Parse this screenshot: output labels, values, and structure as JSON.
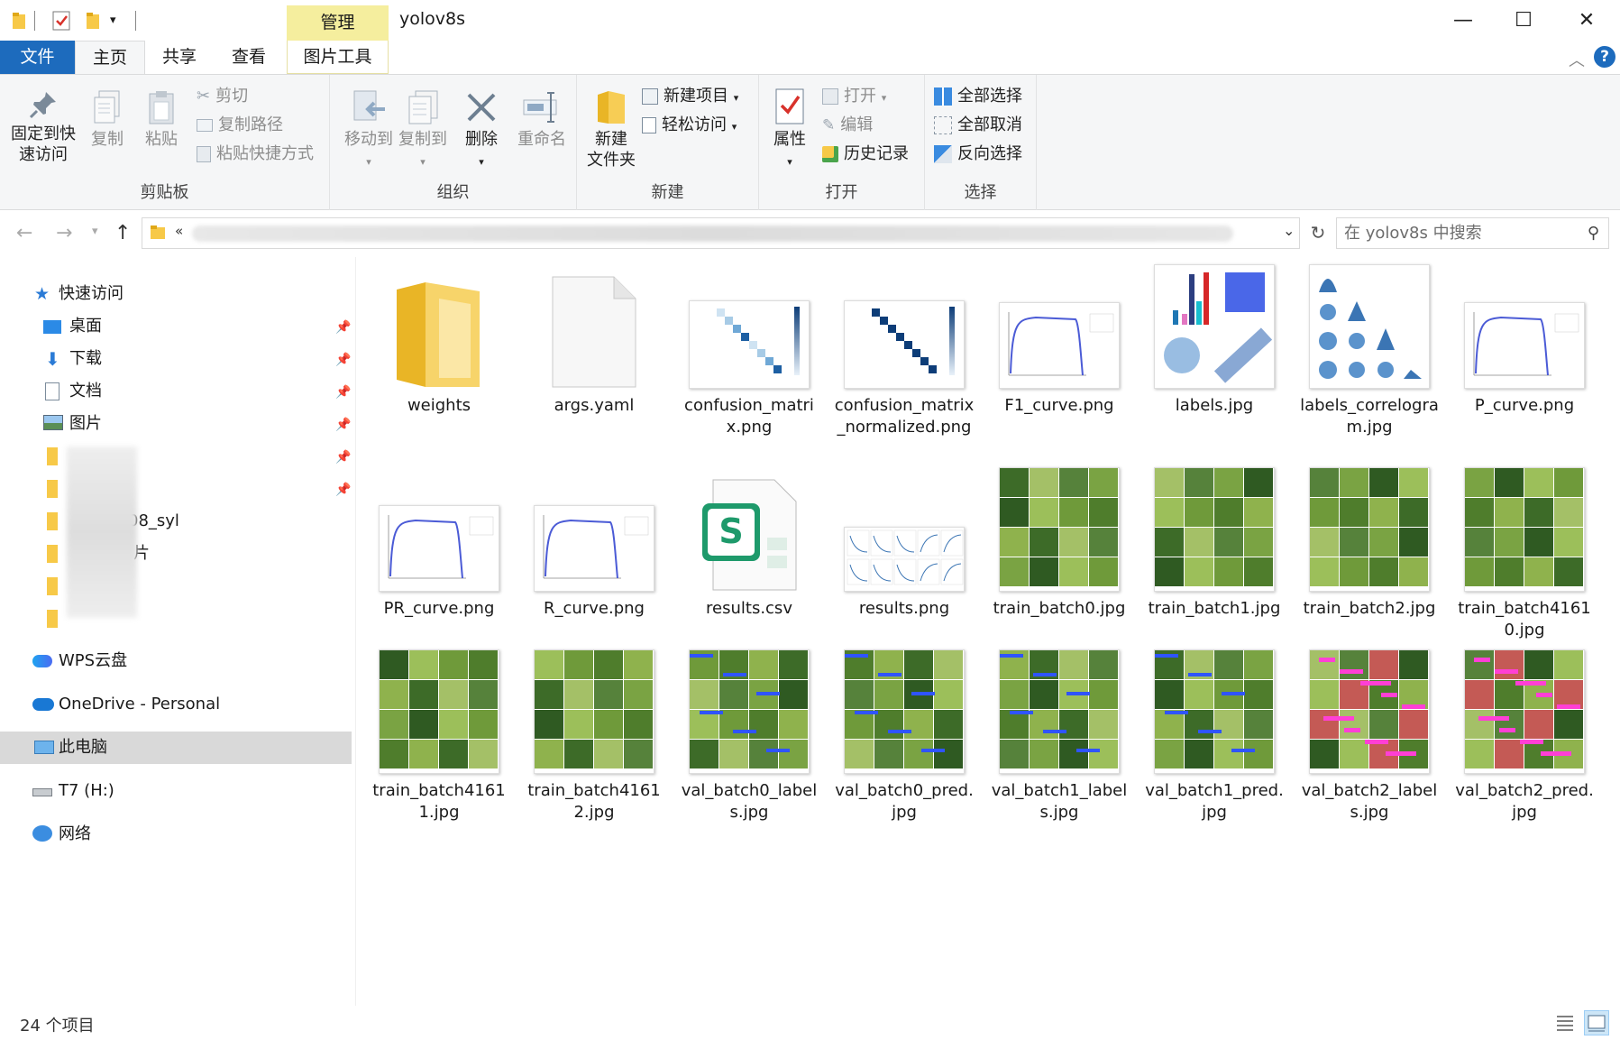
{
  "window": {
    "title": "yolov8s",
    "manage_tab": "管理",
    "minimize": "—",
    "maximize": "☐",
    "close": "✕"
  },
  "ribbon_tabs": {
    "file": "文件",
    "home": "主页",
    "share": "共享",
    "view": "查看",
    "picture_tools": "图片工具"
  },
  "ribbon": {
    "clipboard": {
      "group_label": "剪贴板",
      "pin_label_1": "固定到快",
      "pin_label_2": "速访问",
      "copy": "复制",
      "paste": "粘贴",
      "cut": "剪切",
      "copy_path": "复制路径",
      "paste_shortcut": "粘贴快捷方式"
    },
    "organize": {
      "group_label": "组织",
      "move_to": "移动到",
      "copy_to": "复制到",
      "delete": "删除",
      "rename": "重命名"
    },
    "new": {
      "group_label": "新建",
      "new_folder_1": "新建",
      "new_folder_2": "文件夹",
      "new_item": "新建项目",
      "easy_access": "轻松访问"
    },
    "open": {
      "group_label": "打开",
      "properties": "属性",
      "open": "打开",
      "edit": "编辑",
      "history": "历史记录"
    },
    "select": {
      "group_label": "选择",
      "select_all": "全部选择",
      "select_none": "全部取消",
      "invert": "反向选择"
    }
  },
  "address": {
    "chevron": "«",
    "search_placeholder": "在 yolov8s 中搜索"
  },
  "nav": {
    "quick_access": "快速访问",
    "desktop": "桌面",
    "downloads": "下载",
    "documents": "文档",
    "pictures": "图片",
    "partial_1": "08_syl",
    "partial_2": "片",
    "partial_3": " ",
    "wps": "WPS云盘",
    "onedrive": "OneDrive - Personal",
    "this_pc": "此电脑",
    "t7": "T7 (H:)",
    "network": "网络"
  },
  "files": [
    {
      "name": "weights",
      "kind": "folder"
    },
    {
      "name": "args.yaml",
      "kind": "blank"
    },
    {
      "name": "confusion_matrix.png",
      "kind": "matrix"
    },
    {
      "name": "confusion_matrix_normalized.png",
      "kind": "matrix2"
    },
    {
      "name": "F1_curve.png",
      "kind": "curve"
    },
    {
      "name": "labels.jpg",
      "kind": "labels"
    },
    {
      "name": "labels_correlogram.jpg",
      "kind": "correlogram"
    },
    {
      "name": "P_curve.png",
      "kind": "curve"
    },
    {
      "name": "PR_curve.png",
      "kind": "curve"
    },
    {
      "name": "R_curve.png",
      "kind": "curve"
    },
    {
      "name": "results.csv",
      "kind": "csv"
    },
    {
      "name": "results.png",
      "kind": "results"
    },
    {
      "name": "train_batch0.jpg",
      "kind": "photo"
    },
    {
      "name": "train_batch1.jpg",
      "kind": "photo"
    },
    {
      "name": "train_batch2.jpg",
      "kind": "photo"
    },
    {
      "name": "train_batch41610.jpg",
      "kind": "photo"
    },
    {
      "name": "train_batch41611.jpg",
      "kind": "photo"
    },
    {
      "name": "train_batch41612.jpg",
      "kind": "photo"
    },
    {
      "name": "val_batch0_labels.jpg",
      "kind": "photo"
    },
    {
      "name": "val_batch0_pred.jpg",
      "kind": "photo"
    },
    {
      "name": "val_batch1_labels.jpg",
      "kind": "photo"
    },
    {
      "name": "val_batch1_pred.jpg",
      "kind": "photo"
    },
    {
      "name": "val_batch2_labels.jpg",
      "kind": "photo-pink"
    },
    {
      "name": "val_batch2_pred.jpg",
      "kind": "photo-pink"
    }
  ],
  "status": {
    "item_count": "24 个项目"
  }
}
